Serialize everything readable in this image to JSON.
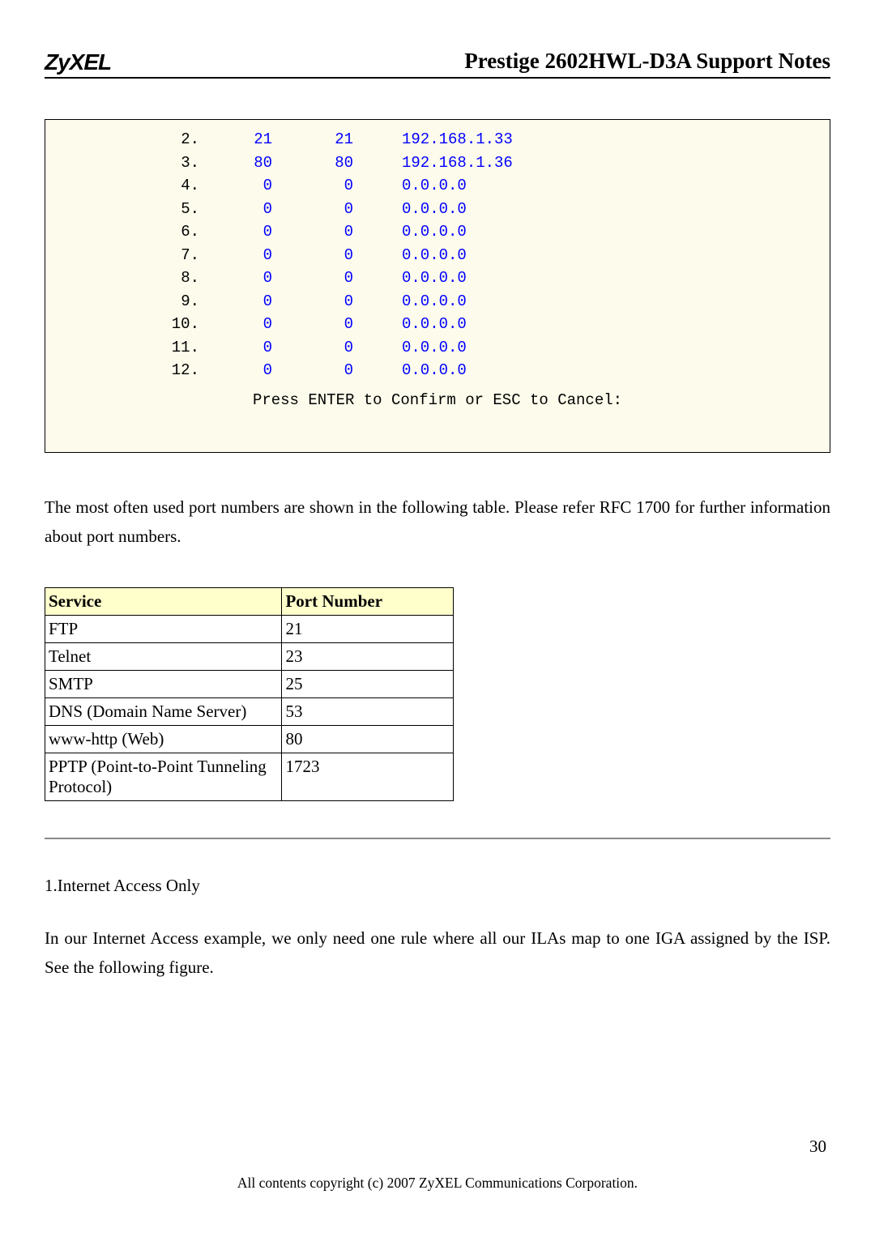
{
  "header": {
    "logo": "ZyXEL",
    "title": "Prestige 2602HWL-D3A Support Notes"
  },
  "terminal": {
    "rows": [
      {
        "idx": "2.",
        "c1": "21",
        "c2": "21",
        "ip": "192.168.1.33"
      },
      {
        "idx": "3.",
        "c1": "80",
        "c2": "80",
        "ip": "192.168.1.36"
      },
      {
        "idx": "4.",
        "c1": "0",
        "c2": "0",
        "ip": "0.0.0.0"
      },
      {
        "idx": "5.",
        "c1": "0",
        "c2": "0",
        "ip": "0.0.0.0"
      },
      {
        "idx": "6.",
        "c1": "0",
        "c2": "0",
        "ip": "0.0.0.0"
      },
      {
        "idx": "7.",
        "c1": "0",
        "c2": "0",
        "ip": "0.0.0.0"
      },
      {
        "idx": "8.",
        "c1": "0",
        "c2": "0",
        "ip": "0.0.0.0"
      },
      {
        "idx": "9.",
        "c1": "0",
        "c2": "0",
        "ip": "0.0.0.0"
      },
      {
        "idx": "10.",
        "c1": "0",
        "c2": "0",
        "ip": "0.0.0.0"
      },
      {
        "idx": "11.",
        "c1": "0",
        "c2": "0",
        "ip": "0.0.0.0"
      },
      {
        "idx": "12.",
        "c1": "0",
        "c2": "0",
        "ip": "0.0.0.0"
      }
    ],
    "footer": "Press ENTER to Confirm or ESC to Cancel:"
  },
  "paragraph1": "The most often used port numbers are shown in the following table. Please refer RFC 1700 for further information about port numbers.",
  "port_table": {
    "headers": {
      "service": "Service",
      "port": "Port Number"
    },
    "rows": [
      {
        "service": "FTP",
        "port": "21"
      },
      {
        "service": "Telnet",
        "port": "23"
      },
      {
        "service": "SMTP",
        "port": "25"
      },
      {
        "service": "DNS (Domain Name Server)",
        "port": "53"
      },
      {
        "service": "www-http (Web)",
        "port": "80"
      },
      {
        "service": "PPTP (Point-to-Point Tunneling Protocol)",
        "port": "1723"
      }
    ]
  },
  "section": {
    "heading": "1.Internet Access Only",
    "body": "In our Internet Access example, we only need one rule where all our ILAs map to one IGA assigned by the ISP. See the following figure."
  },
  "footer": {
    "page_number": "30",
    "copyright": "All contents copyright (c) 2007 ZyXEL Communications Corporation."
  }
}
